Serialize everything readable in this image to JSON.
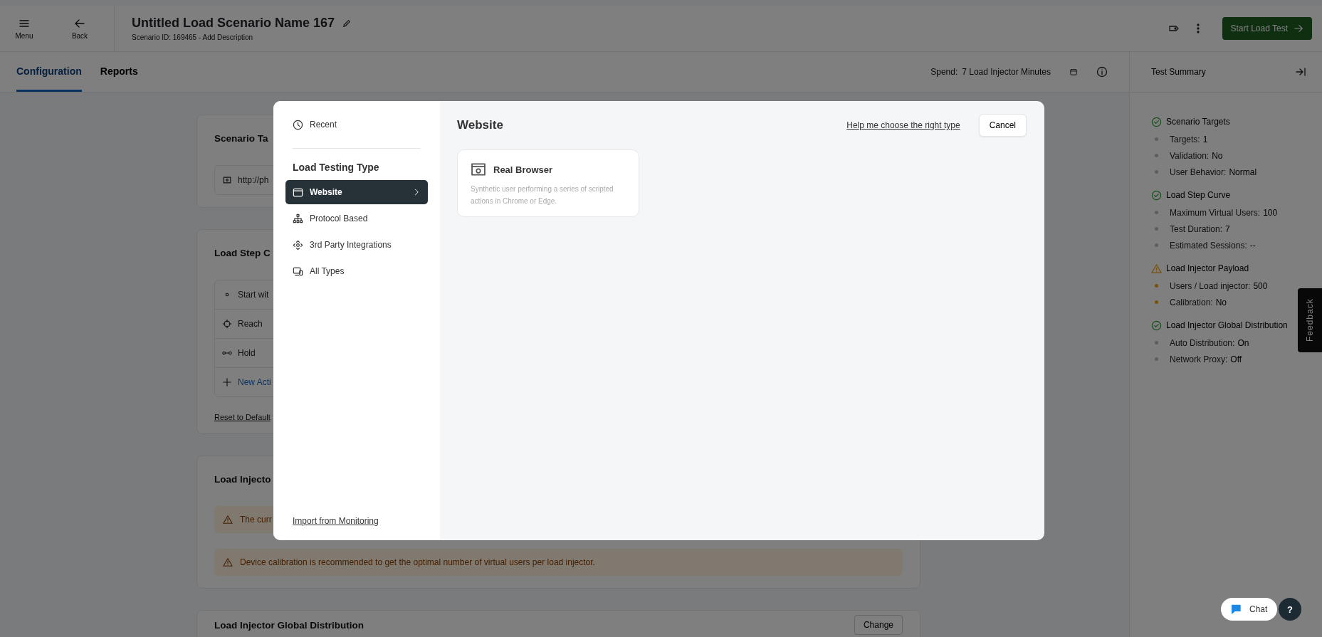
{
  "header": {
    "menu_button": "Menu",
    "back_button": "Back",
    "title": "Untitled Load Scenario Name 167",
    "subtitle": "Scenario ID: 169465 - Add Description",
    "start_button": "Start Load Test"
  },
  "tabs": [
    {
      "label": "Configuration",
      "selected": true
    },
    {
      "label": "Reports",
      "selected": false
    }
  ],
  "spend": {
    "label": "Spend:",
    "value": "7 Load Injector Minutes"
  },
  "cards": [
    {
      "title": "Scenario Ta",
      "rows": [
        {
          "kind": "url",
          "text": "http://ph"
        }
      ]
    },
    {
      "title": "Load Step C",
      "rows": [
        {
          "kind": "dot",
          "text": "Start wit"
        },
        {
          "kind": "target",
          "text": "Reach"
        },
        {
          "kind": "hold",
          "text": "Hold"
        },
        {
          "kind": "add",
          "text": "New Acti"
        }
      ],
      "link": "Reset to Default"
    },
    {
      "title": "Load Injecto",
      "warnings": [
        "The curr",
        "Device calibration is recommended to get the optimal number of virtual users per load injector."
      ]
    },
    {
      "title": "Load Injector Global Distribution",
      "button": "Change"
    }
  ],
  "summary": {
    "title": "Test Summary",
    "sections": [
      {
        "title": "Scenario Targets",
        "warning": false,
        "items": [
          {
            "label": "Targets:",
            "value": "1"
          },
          {
            "label": "Validation:",
            "value": "No"
          },
          {
            "label": "User Behavior:",
            "value": "Normal"
          }
        ]
      },
      {
        "title": "Load Step Curve",
        "warning": false,
        "items": [
          {
            "label": "Maximum Virtual Users:",
            "value": "100"
          },
          {
            "label": "Test Duration:",
            "value": "7"
          },
          {
            "label": "Estimated Sessions:",
            "value": "--"
          }
        ]
      },
      {
        "title": "Load Injector Payload",
        "warning": true,
        "items": [
          {
            "label": "Users / Load injector:",
            "value": "500"
          },
          {
            "label": "Calibration:",
            "value": "No"
          }
        ]
      },
      {
        "title": "Load Injector Global Distribution",
        "warning": false,
        "items": [
          {
            "label": "Auto Distribution:",
            "value": "On"
          },
          {
            "label": "Network Proxy:",
            "value": "Off"
          }
        ]
      }
    ]
  },
  "feedback": "Feedback",
  "chat": "Chat",
  "help": "?",
  "modal": {
    "recent": "Recent",
    "section_title": "Load Testing Type",
    "nav": [
      {
        "label": "Website",
        "selected": true
      },
      {
        "label": "Protocol Based",
        "selected": false
      },
      {
        "label": "3rd Party Integrations",
        "selected": false
      },
      {
        "label": "All Types",
        "selected": false
      }
    ],
    "import_link": "Import from Monitoring",
    "heading": "Website",
    "help_link": "Help me choose the right type",
    "cancel": "Cancel",
    "options": [
      {
        "title": "Real Browser",
        "description": "Synthetic user performing a series of scripted actions in Chrome or Edge."
      }
    ]
  }
}
